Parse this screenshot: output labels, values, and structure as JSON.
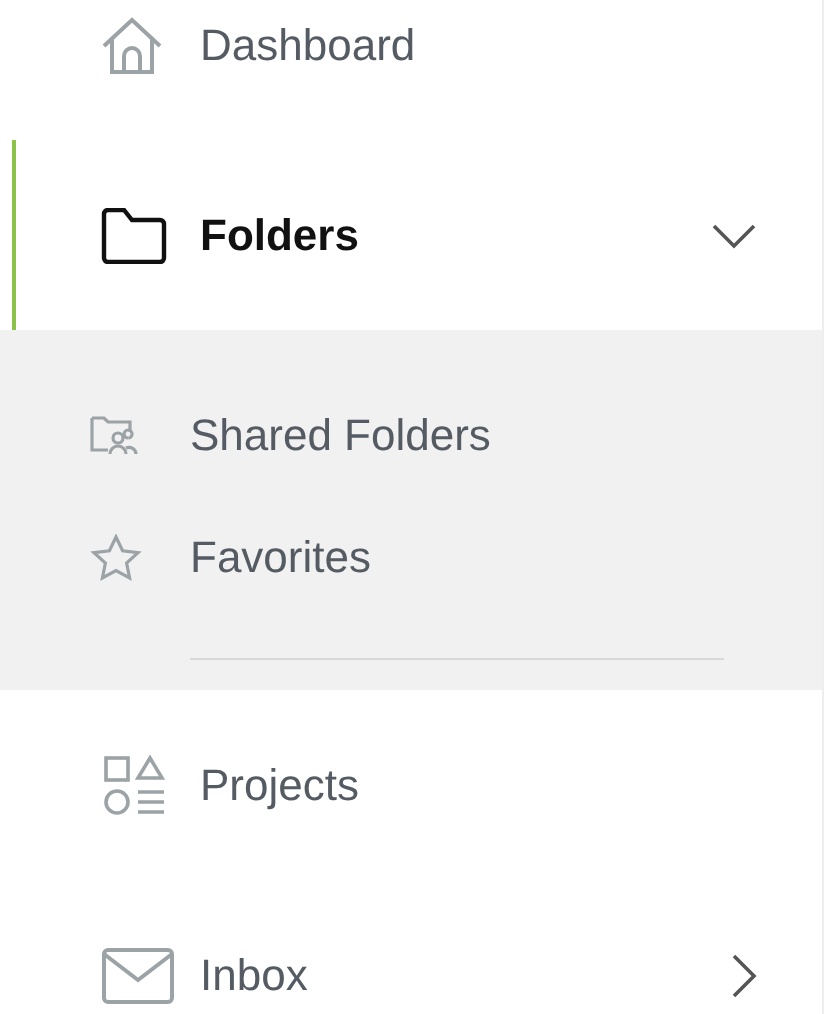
{
  "nav": [
    {
      "kind": "link",
      "label": "Dashboard",
      "selected": false
    },
    {
      "kind": "group",
      "label": "Folders",
      "selected": true,
      "expanded": true,
      "children": [
        {
          "label": "Shared Folders"
        },
        {
          "label": "Favorites"
        }
      ]
    },
    {
      "kind": "link",
      "label": "Projects",
      "selected": false
    },
    {
      "kind": "group",
      "label": "Inbox",
      "selected": false,
      "expanded": false
    }
  ]
}
